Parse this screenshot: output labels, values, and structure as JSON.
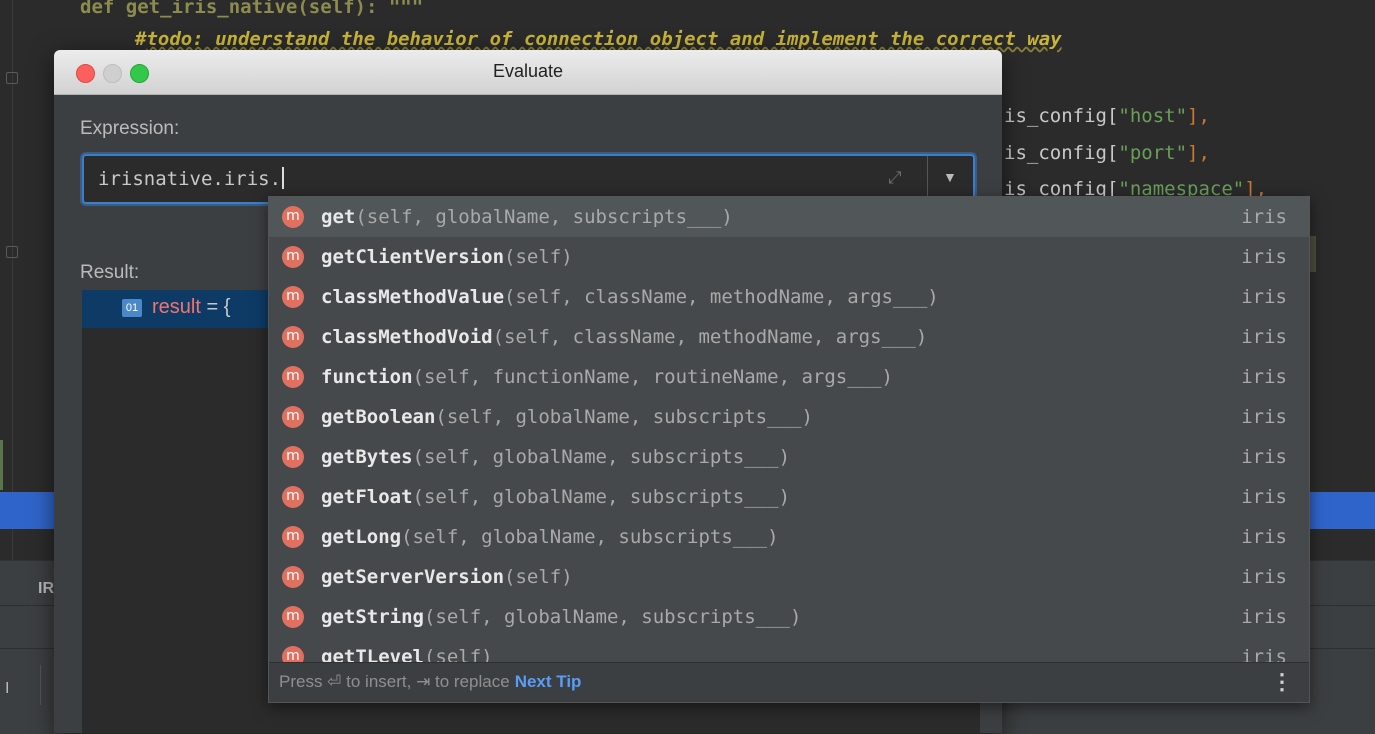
{
  "editor": {
    "top_cut_text": "def get_iris_native(self): \"\"\"",
    "todo_prefix": "#",
    "todo_text": "todo: understand the behavior of connection object and implement the correct way",
    "code_lines": [
      {
        "prefix": "is_config[",
        "str": "\"host\"",
        "suffix": "],"
      },
      {
        "prefix": "is_config[",
        "str": "\"port\"",
        "suffix": "],"
      },
      {
        "prefix": "is_config[",
        "str": "\"namespace\"",
        "suffix": "],"
      }
    ],
    "bottom_tab": "IR",
    "bottom_icon": "I"
  },
  "dialog": {
    "title": "Evaluate",
    "expression_label": "Expression:",
    "expression_value": "irisnative.iris.",
    "result_label": "Result:",
    "result_badge": "01",
    "result_var": "result",
    "result_eq": " = {"
  },
  "completion": {
    "items": [
      {
        "badge": "m",
        "name": "get",
        "params": "(self, globalName, subscripts___)",
        "type": "iris"
      },
      {
        "badge": "m",
        "name": "getClientVersion",
        "params": "(self)",
        "type": "iris"
      },
      {
        "badge": "m",
        "name": "classMethodValue",
        "params": "(self, className, methodName, args___)",
        "type": "iris"
      },
      {
        "badge": "m",
        "name": "classMethodVoid",
        "params": "(self, className, methodName, args___)",
        "type": "iris"
      },
      {
        "badge": "m",
        "name": "function",
        "params": "(self, functionName, routineName, args___)",
        "type": "iris"
      },
      {
        "badge": "m",
        "name": "getBoolean",
        "params": "(self, globalName, subscripts___)",
        "type": "iris"
      },
      {
        "badge": "m",
        "name": "getBytes",
        "params": "(self, globalName, subscripts___)",
        "type": "iris"
      },
      {
        "badge": "m",
        "name": "getFloat",
        "params": "(self, globalName, subscripts___)",
        "type": "iris"
      },
      {
        "badge": "m",
        "name": "getLong",
        "params": "(self, globalName, subscripts___)",
        "type": "iris"
      },
      {
        "badge": "m",
        "name": "getServerVersion",
        "params": "(self)",
        "type": "iris"
      },
      {
        "badge": "m",
        "name": "getString",
        "params": "(self, globalName, subscripts___)",
        "type": "iris"
      },
      {
        "badge": "m",
        "name": "getTLevel",
        "params": "(self)",
        "type": "iris"
      }
    ],
    "footer_hint": "Press ⏎ to insert, ⇥ to replace",
    "next_tip": "Next Tip"
  },
  "colors": {
    "accent": "#3d7ec9",
    "method_badge": "#e07160",
    "link": "#589df6",
    "selection": "#2f65ca"
  },
  "icons": {
    "expand": "expand-icon",
    "dropdown": "chevron-down-icon",
    "menu": "more-vertical-icon"
  }
}
